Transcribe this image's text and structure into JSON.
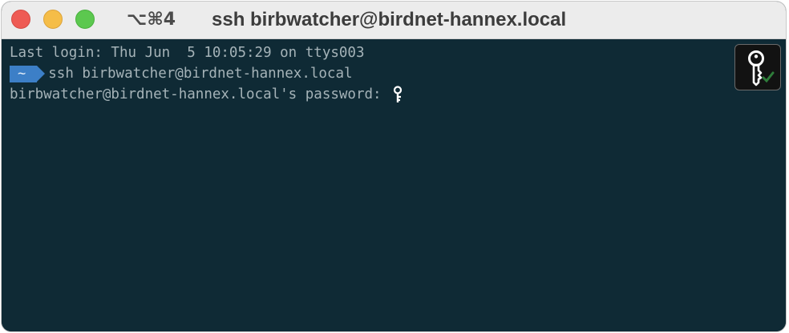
{
  "window": {
    "shortcut": "⌥⌘4",
    "title": "ssh birbwatcher@birdnet-hannex.local"
  },
  "terminal": {
    "last_login": "Last login: Thu Jun  5 10:05:29 on ttys003",
    "prompt_dir": "~",
    "command": "ssh birbwatcher@birdnet-hannex.local",
    "password_prompt": "birbwatcher@birdnet-hannex.local's password: "
  },
  "icons": {
    "close": "close-button",
    "minimize": "minimize-button",
    "maximize": "maximize-button",
    "key_cursor": "key-icon",
    "password_key": "key-icon"
  },
  "colors": {
    "terminal_bg": "#0f2a35",
    "terminal_text": "#a5b3b8",
    "prompt_badge": "#3c7fc7"
  }
}
